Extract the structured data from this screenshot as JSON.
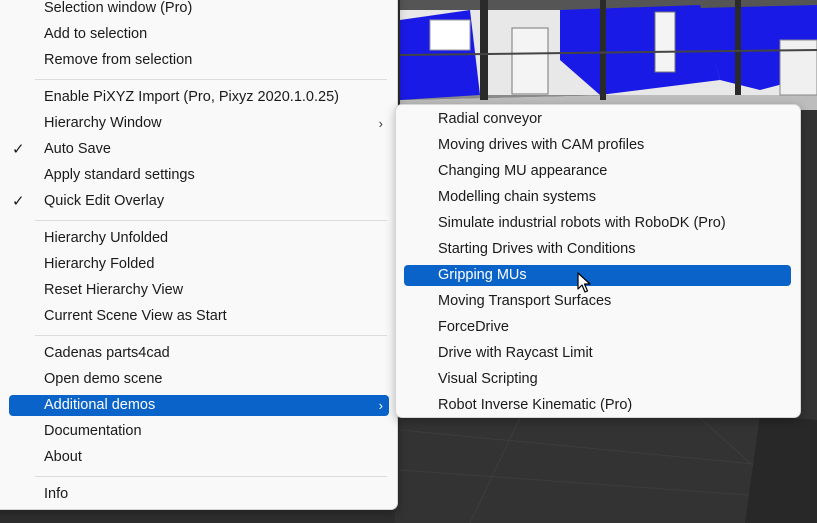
{
  "main_menu": {
    "items": [
      {
        "label": "Selection window (Pro)"
      },
      {
        "label": "Add to selection"
      },
      {
        "label": "Remove from selection"
      },
      {
        "label": "Enable PiXYZ Import (Pro, Pixyz 2020.1.0.25)"
      },
      {
        "label": "Hierarchy Window",
        "submenu_arrow": "›"
      },
      {
        "label": "Auto Save",
        "check": "✓"
      },
      {
        "label": "Apply standard settings"
      },
      {
        "label": "Quick Edit Overlay",
        "check": "✓"
      },
      {
        "label": "Hierarchy Unfolded"
      },
      {
        "label": "Hierarchy Folded"
      },
      {
        "label": "Reset Hierarchy View"
      },
      {
        "label": "Current Scene View as Start"
      },
      {
        "label": "Cadenas parts4cad"
      },
      {
        "label": "Open demo scene"
      },
      {
        "label": "Additional demos",
        "submenu_arrow": "›"
      },
      {
        "label": "Documentation"
      },
      {
        "label": "About"
      },
      {
        "label": "Info"
      }
    ]
  },
  "submenu": {
    "items": [
      {
        "label": "Radial conveyor"
      },
      {
        "label": "Moving drives with CAM profiles"
      },
      {
        "label": "Changing MU appearance"
      },
      {
        "label": "Modelling chain systems"
      },
      {
        "label": "Simulate industrial robots with RoboDK (Pro)"
      },
      {
        "label": "Starting Drives with Conditions"
      },
      {
        "label": "Gripping MUs"
      },
      {
        "label": "Moving Transport Surfaces"
      },
      {
        "label": "ForceDrive"
      },
      {
        "label": "Drive with Raycast Limit"
      },
      {
        "label": "Visual Scripting"
      },
      {
        "label": "Robot Inverse Kinematic (Pro)"
      }
    ]
  },
  "state": {
    "main_selected": "Additional demos",
    "submenu_hovered": "Gripping MUs"
  },
  "icons": {
    "checkmark": "checkmark-icon",
    "submenu": "chevron-right-icon",
    "cursor": "mouse-pointer-icon"
  },
  "colors": {
    "menu_background": "#f9f9f9",
    "selection": "#0a63c9",
    "model_blue": "#1a1ae6",
    "scene_background": "#2f2f2f"
  }
}
